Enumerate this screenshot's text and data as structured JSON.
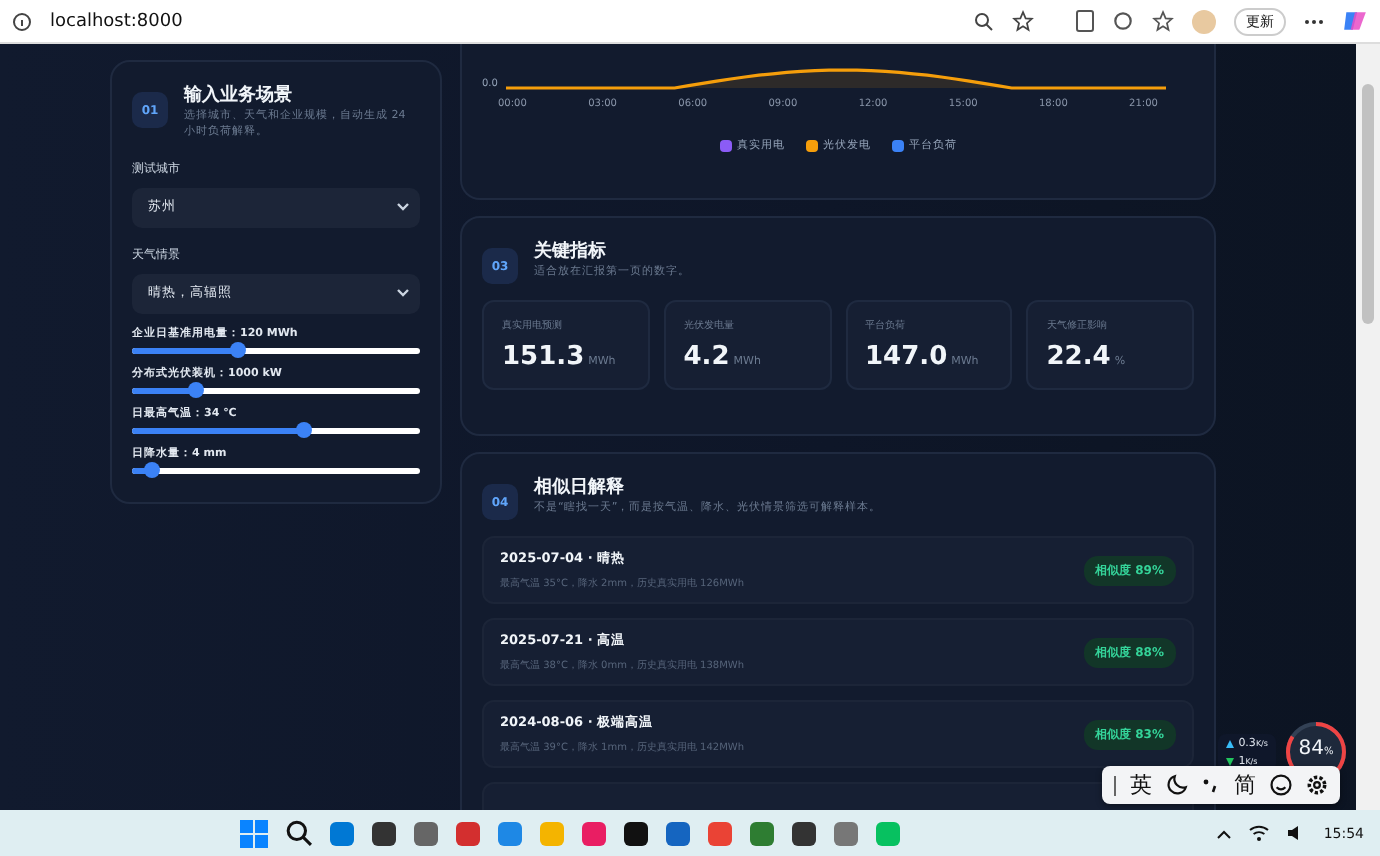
{
  "browser": {
    "address": "localhost:8000",
    "update_button": "更新"
  },
  "input_panel": {
    "step": "01",
    "title": "输入业务场景",
    "subtitle": "选择城市、天气和企业规模，自动生成 24 小时负荷解释。",
    "selects": [
      {
        "label": "测试城市",
        "value": "苏州"
      },
      {
        "label": "天气情景",
        "value": "晴热，高辐照"
      }
    ],
    "sliders": [
      {
        "label": "企业日基准用电量：120 MWh",
        "level": 0.37
      },
      {
        "label": "分布式光伏装机：1000 kW",
        "level": 0.22
      },
      {
        "label": "日最高气温：34 ℃",
        "level": 0.6
      },
      {
        "label": "日降水量：4 mm",
        "level": 0.07
      }
    ]
  },
  "chart_panel": {
    "y_tick": "0.0",
    "x_labels": [
      "00:00",
      "03:00",
      "06:00",
      "09:00",
      "12:00",
      "15:00",
      "18:00",
      "21:00"
    ],
    "legend": [
      {
        "label": "真实用电",
        "color": "#8b5cf6"
      },
      {
        "label": "光伏发电",
        "color": "#f59e0b"
      },
      {
        "label": "平台负荷",
        "color": "#3b82f6"
      }
    ]
  },
  "metrics_panel": {
    "step": "03",
    "title": "关键指标",
    "subtitle": "适合放在汇报第一页的数字。",
    "metrics": [
      {
        "label": "真实用电预测",
        "value": "151.3",
        "unit": "MWh"
      },
      {
        "label": "光伏发电量",
        "value": "4.2",
        "unit": "MWh"
      },
      {
        "label": "平台负荷",
        "value": "147.0",
        "unit": "MWh"
      },
      {
        "label": "天气修正影响",
        "value": "22.4",
        "unit": "%"
      }
    ]
  },
  "similar_panel": {
    "step": "04",
    "title": "相似日解释",
    "subtitle": "不是“瞎找一天”，而是按气温、降水、光伏情景筛选可解释样本。",
    "days": [
      {
        "title": "2025-07-04 · 晴热",
        "detail": "最高气温 35°C，降水 2mm，历史真实用电 126MWh",
        "badge": "相似度 89%"
      },
      {
        "title": "2025-07-21 · 高温",
        "detail": "最高气温 38°C，降水 0mm，历史真实用电 138MWh",
        "badge": "相似度 88%"
      },
      {
        "title": "2024-08-06 · 极端高温",
        "detail": "最高气温 39°C，降水 1mm，历史真实用电 142MWh",
        "badge": "相似度 83%"
      }
    ]
  },
  "net_widget": {
    "upload": "0.3",
    "upload_unit": "K/s",
    "download": "1",
    "download_unit": "K/s",
    "gauge": "84",
    "gauge_unit": "%"
  },
  "ime_bar": [
    "英",
    "简"
  ],
  "taskbar": {
    "time": "15:54"
  }
}
